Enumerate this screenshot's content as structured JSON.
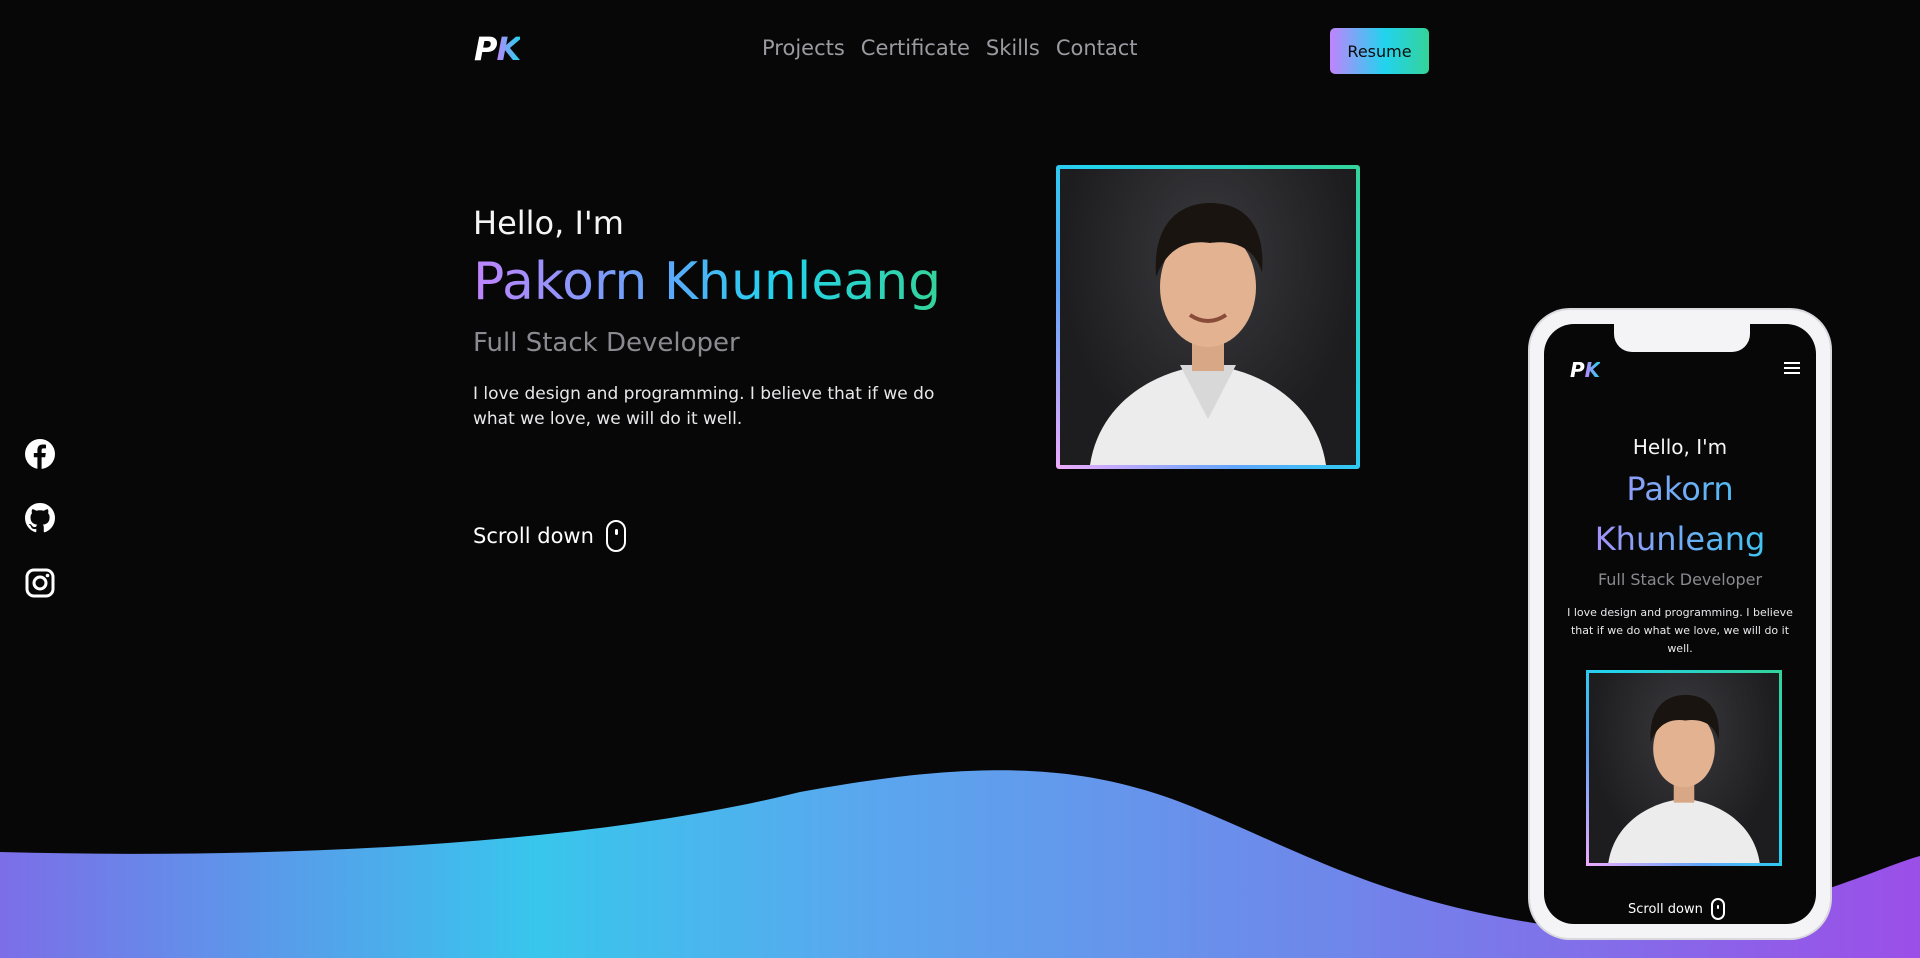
{
  "header": {
    "logo": {
      "p": "P",
      "k": "K"
    },
    "nav": [
      {
        "label": "Projects"
      },
      {
        "label": "Certificate"
      },
      {
        "label": "Skills"
      },
      {
        "label": "Contact"
      }
    ],
    "resume_label": "Resume"
  },
  "social": [
    {
      "icon": "facebook-icon"
    },
    {
      "icon": "github-icon"
    },
    {
      "icon": "instagram-icon"
    }
  ],
  "hero": {
    "greeting": "Hello, I'm",
    "name": "Pakorn Khunleang",
    "role": "Full Stack Developer",
    "bio": "I love design and programming. I believe that if we do what we love, we will do it well.",
    "scroll_label": "Scroll down"
  },
  "mobile": {
    "logo": {
      "p": "P",
      "k": "K"
    },
    "greeting": "Hello, I'm",
    "name": "Pakorn Khunleang",
    "role": "Full Stack Developer",
    "bio": "I love design and programming. I believe that if we do what we love, we will do it well.",
    "scroll_label": "Scroll down"
  },
  "colors": {
    "background": "#070708",
    "gradient_purple": "#c084fc",
    "gradient_cyan": "#22d3ee",
    "gradient_green": "#34d399",
    "wave_blue": "#5aa7ee",
    "wave_violet": "#8b5cf6"
  }
}
